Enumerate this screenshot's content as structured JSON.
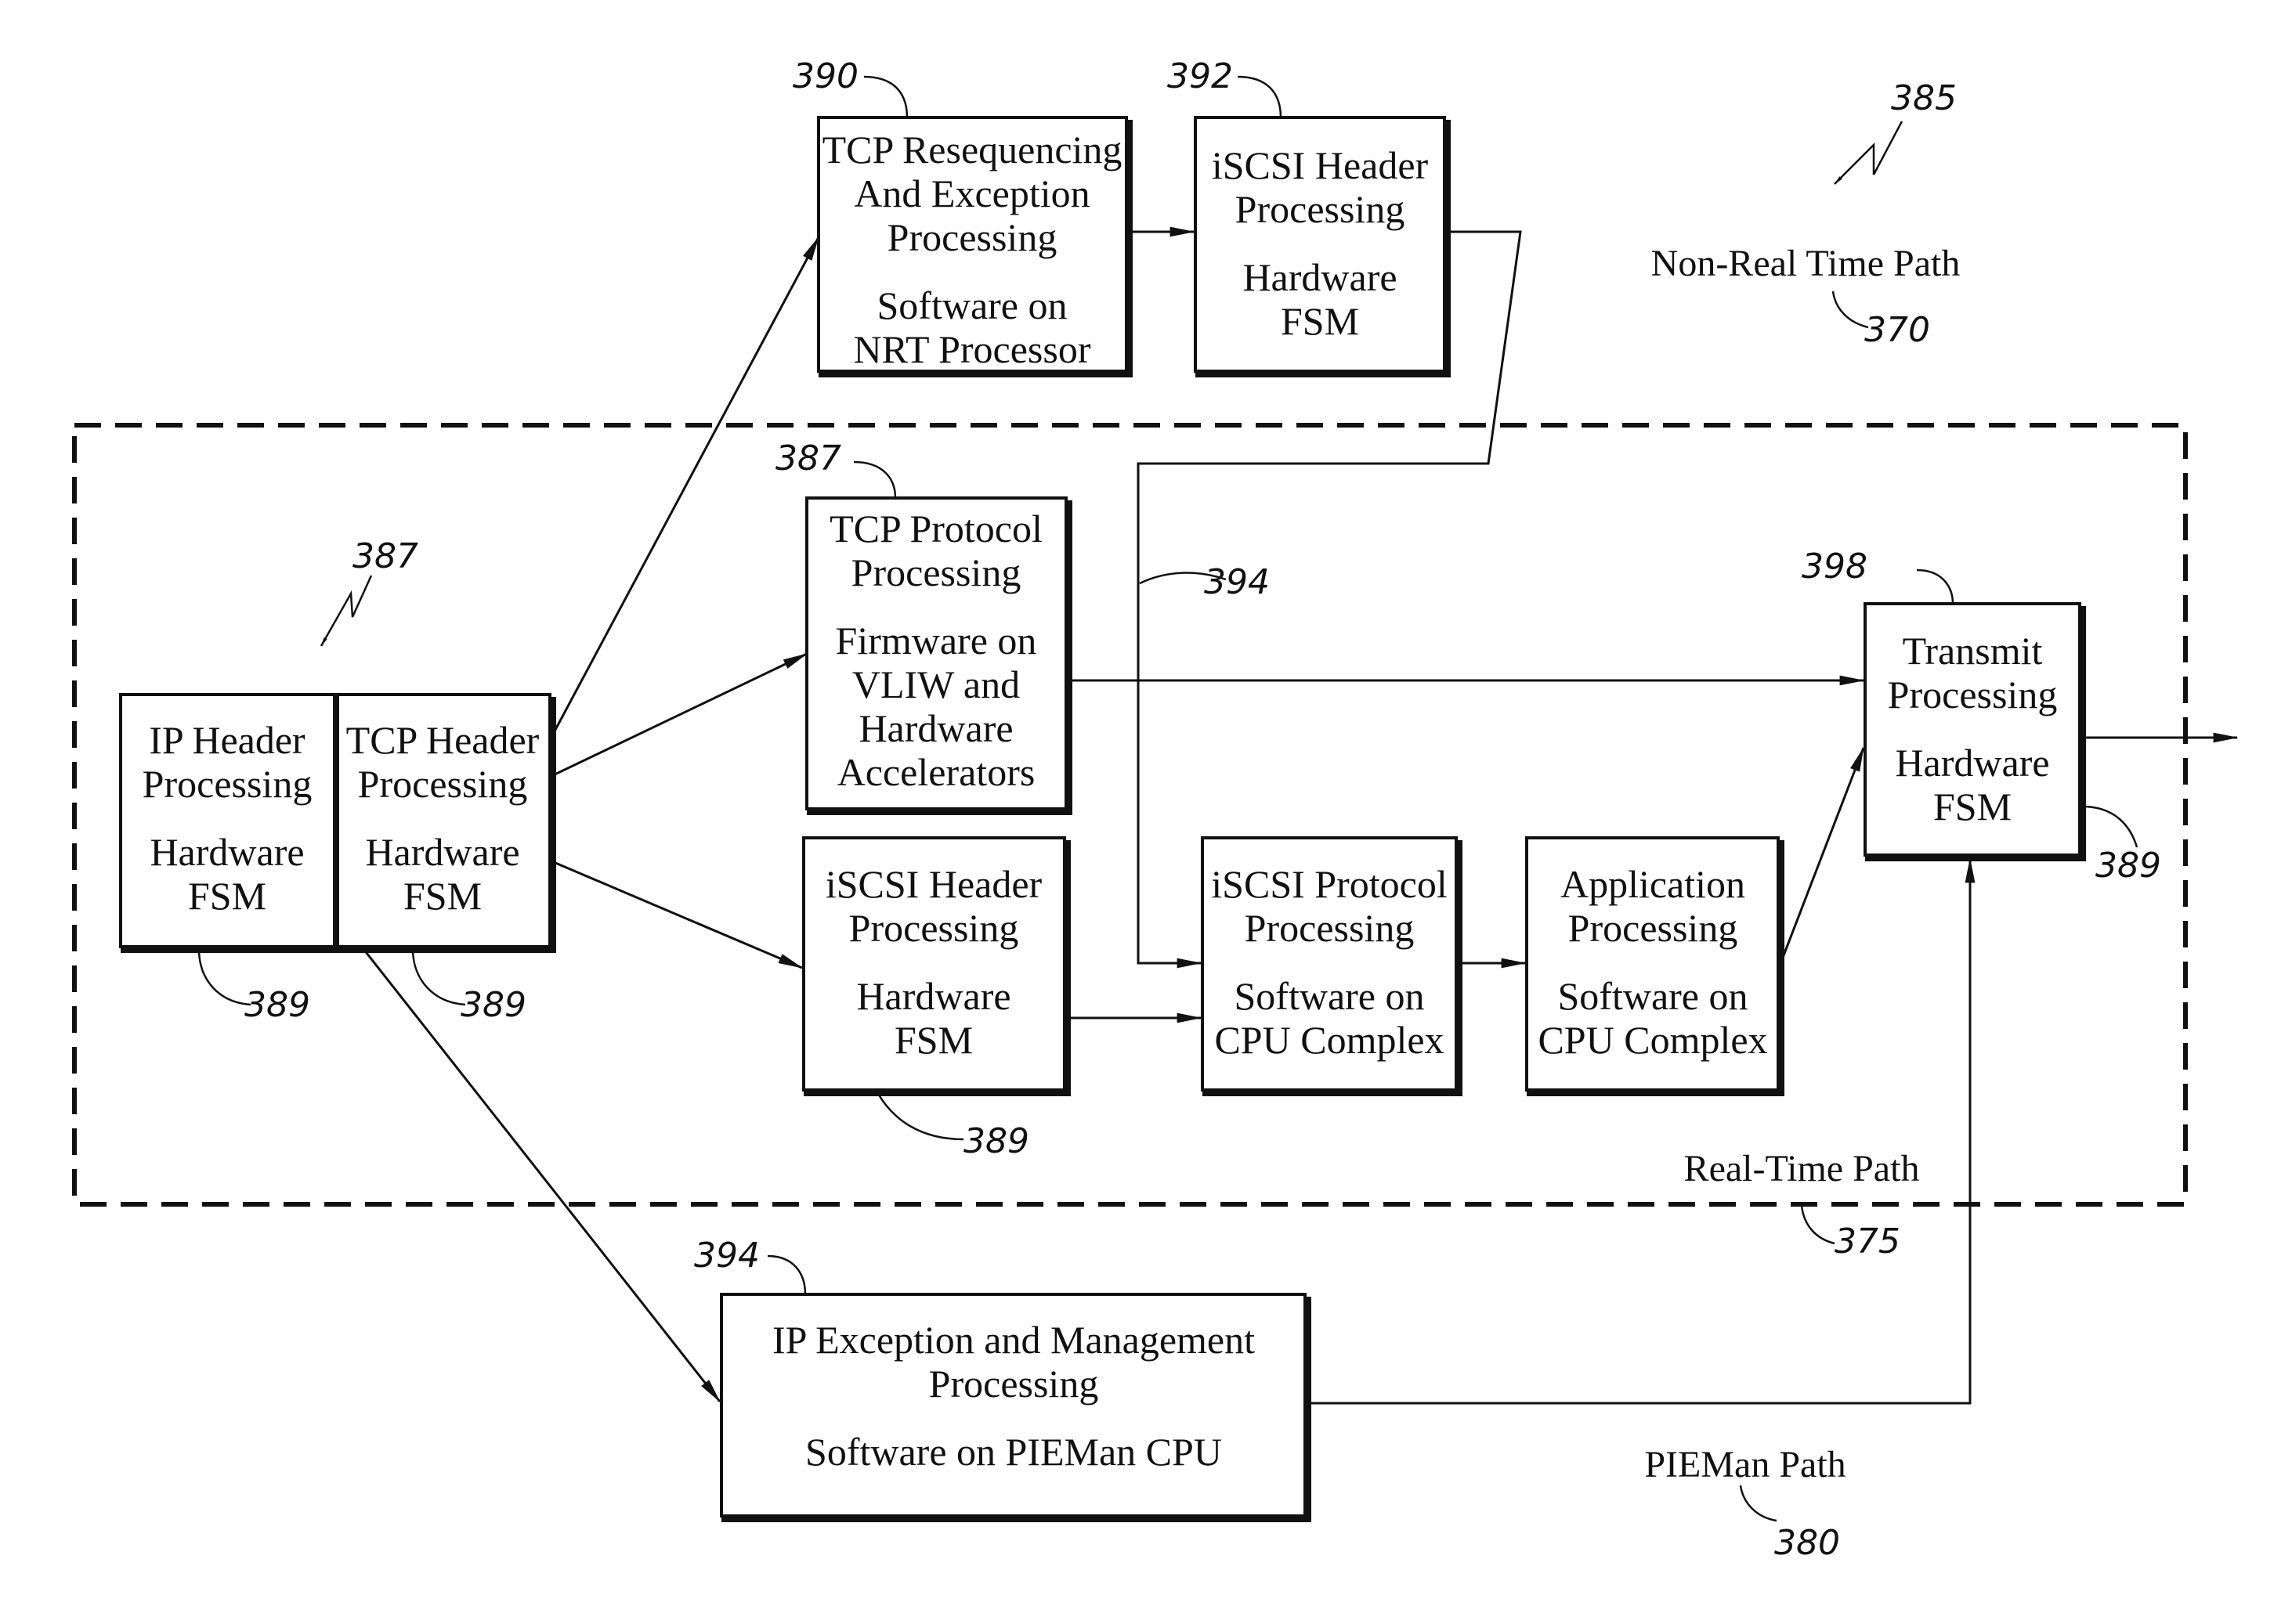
{
  "colors": {
    "ink": "#111111",
    "background": "#ffffff"
  },
  "regions": {
    "non_real_time": {
      "label": "Non-Real Time Path",
      "ref": "370"
    },
    "real_time": {
      "label": "Real-Time Path",
      "ref": "375"
    },
    "pieman": {
      "label": "PIEMan Path",
      "ref": "380"
    },
    "figure_refs": {
      "top_right": "385",
      "left_group": "387"
    }
  },
  "boxes": [
    {
      "id": "ip-header",
      "ref": "389",
      "lines": [
        "IP Header",
        "Processing",
        "",
        "Hardware",
        "FSM"
      ]
    },
    {
      "id": "tcp-header",
      "ref": "389",
      "lines": [
        "TCP Header",
        "Processing",
        "",
        "Hardware",
        "FSM"
      ]
    },
    {
      "id": "tcp-resequencing",
      "ref": "390",
      "lines": [
        "TCP Resequencing",
        "And Exception",
        "Processing",
        "",
        "Software on",
        "NRT Processor"
      ]
    },
    {
      "id": "iscsi-header-nrt",
      "ref": "392",
      "lines": [
        "iSCSI Header",
        "Processing",
        "",
        "Hardware",
        "FSM"
      ]
    },
    {
      "id": "tcp-protocol",
      "ref": "387",
      "lines": [
        "TCP Protocol",
        "Processing",
        "",
        "Firmware on",
        "VLIW and",
        "Hardware",
        "Accelerators"
      ]
    },
    {
      "id": "iscsi-header-rt",
      "ref": "389",
      "lines": [
        "iSCSI Header",
        "Processing",
        "",
        "Hardware",
        "FSM"
      ]
    },
    {
      "id": "iscsi-protocol",
      "ref": "",
      "lines": [
        "iSCSI Protocol",
        "Processing",
        "",
        "Software on",
        "CPU Complex"
      ]
    },
    {
      "id": "application",
      "ref": "",
      "lines": [
        "Application",
        "Processing",
        "",
        "Software on",
        "CPU Complex"
      ]
    },
    {
      "id": "transmit",
      "ref": "398",
      "ref2": "389",
      "lines": [
        "Transmit",
        "Processing",
        "",
        "Hardware",
        "FSM"
      ]
    },
    {
      "id": "ip-exception",
      "ref": "394",
      "lines": [
        "IP Exception and Management",
        "Processing",
        "",
        "Software on PIEMan CPU"
      ]
    }
  ],
  "connector_ref": "394",
  "connections": [
    {
      "from": "tcp-header",
      "to": "tcp-resequencing"
    },
    {
      "from": "tcp-header",
      "to": "tcp-protocol"
    },
    {
      "from": "tcp-header",
      "to": "iscsi-header-rt"
    },
    {
      "from": "tcp-resequencing",
      "to": "iscsi-header-nrt"
    },
    {
      "from": "iscsi-header-nrt",
      "to": "iscsi-protocol"
    },
    {
      "from": "tcp-protocol",
      "to": "transmit"
    },
    {
      "from": "iscsi-header-rt",
      "to": "iscsi-protocol"
    },
    {
      "from": "iscsi-protocol",
      "to": "application"
    },
    {
      "from": "application",
      "to": "transmit"
    },
    {
      "from": "ip-header",
      "to": "ip-exception"
    },
    {
      "from": "ip-exception",
      "to": "transmit"
    },
    {
      "from": "transmit",
      "to": "output"
    }
  ]
}
